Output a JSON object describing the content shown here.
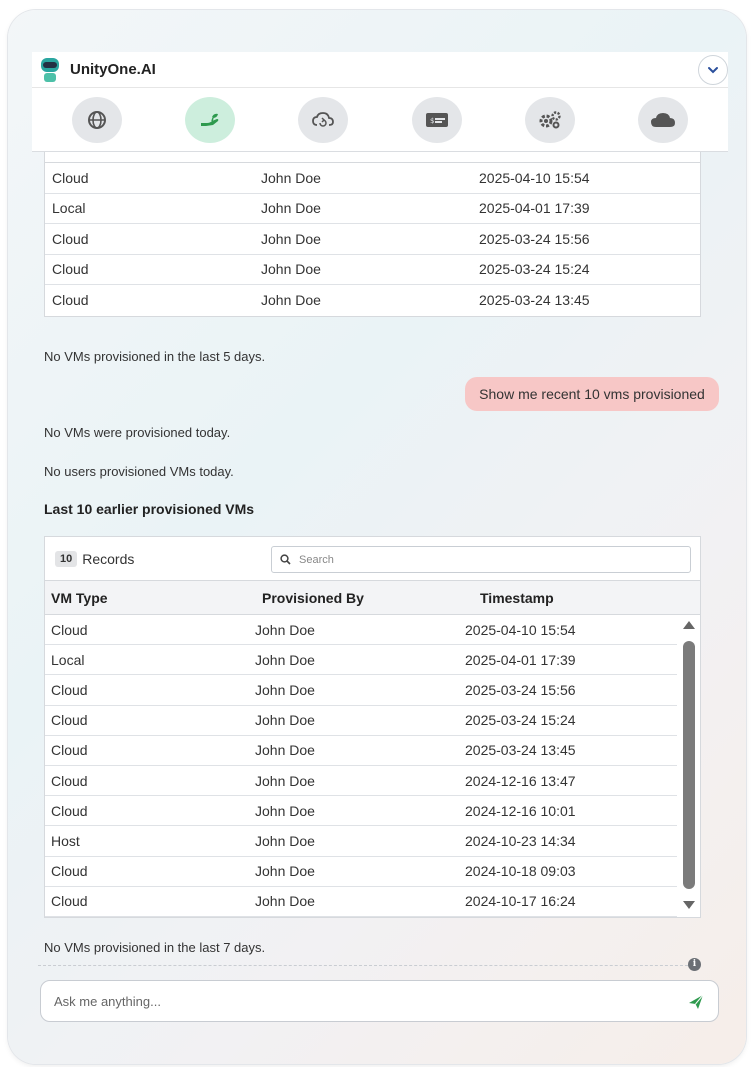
{
  "app": {
    "title": "UnityOne.AI"
  },
  "toolbar": {
    "buttons": [
      {
        "icon": "globe-icon",
        "active": false
      },
      {
        "icon": "hand-plant-icon",
        "active": true
      },
      {
        "icon": "cloud-refresh-icon",
        "active": false
      },
      {
        "icon": "billing-card-icon",
        "active": false
      },
      {
        "icon": "gears-icon",
        "active": false
      },
      {
        "icon": "cloud-icon",
        "active": false
      }
    ],
    "active_color": "#cdeedd"
  },
  "table1": {
    "rows": [
      {
        "vm_type": "Cloud",
        "provisioned_by": "John Doe",
        "timestamp": "2025-04-10 15:54"
      },
      {
        "vm_type": "Local",
        "provisioned_by": "John Doe",
        "timestamp": "2025-04-01 17:39"
      },
      {
        "vm_type": "Cloud",
        "provisioned_by": "John Doe",
        "timestamp": "2025-03-24 15:56"
      },
      {
        "vm_type": "Cloud",
        "provisioned_by": "John Doe",
        "timestamp": "2025-03-24 15:24"
      },
      {
        "vm_type": "Cloud",
        "provisioned_by": "John Doe",
        "timestamp": "2025-03-24 13:45"
      }
    ]
  },
  "messages": {
    "no_vms_5_days": "No VMs provisioned in the last 5 days.",
    "user_query": "Show me recent 10 vms provisioned",
    "no_vms_today": "No VMs were provisioned today.",
    "no_users_today": "No users provisioned VMs today.",
    "last10_heading": "Last 10 earlier provisioned VMs",
    "no_vms_7_days": "No VMs provisioned in the last 7 days."
  },
  "table2": {
    "record_count": "10",
    "records_label": "Records",
    "search_placeholder": "Search",
    "headers": {
      "vm_type": "VM Type",
      "provisioned_by": "Provisioned By",
      "timestamp": "Timestamp"
    },
    "rows": [
      {
        "vm_type": "Cloud",
        "provisioned_by": "John Doe",
        "timestamp": "2025-04-10 15:54"
      },
      {
        "vm_type": "Local",
        "provisioned_by": "John Doe",
        "timestamp": "2025-04-01 17:39"
      },
      {
        "vm_type": "Cloud",
        "provisioned_by": "John Doe",
        "timestamp": "2025-03-24 15:56"
      },
      {
        "vm_type": "Cloud",
        "provisioned_by": "John Doe",
        "timestamp": "2025-03-24 15:24"
      },
      {
        "vm_type": "Cloud",
        "provisioned_by": "John Doe",
        "timestamp": "2025-03-24 13:45"
      },
      {
        "vm_type": "Cloud",
        "provisioned_by": "John Doe",
        "timestamp": "2024-12-16 13:47"
      },
      {
        "vm_type": "Cloud",
        "provisioned_by": "John Doe",
        "timestamp": "2024-12-16 10:01"
      },
      {
        "vm_type": "Host",
        "provisioned_by": "John Doe",
        "timestamp": "2024-10-23 14:34"
      },
      {
        "vm_type": "Cloud",
        "provisioned_by": "John Doe",
        "timestamp": "2024-10-18 09:03"
      },
      {
        "vm_type": "Cloud",
        "provisioned_by": "John Doe",
        "timestamp": "2024-10-17 16:24"
      }
    ]
  },
  "composer": {
    "placeholder": "Ask me anything...",
    "info_glyph": "i"
  },
  "colors": {
    "user_bubble": "#f7c7c6",
    "send_icon": "#2e9a4e"
  }
}
